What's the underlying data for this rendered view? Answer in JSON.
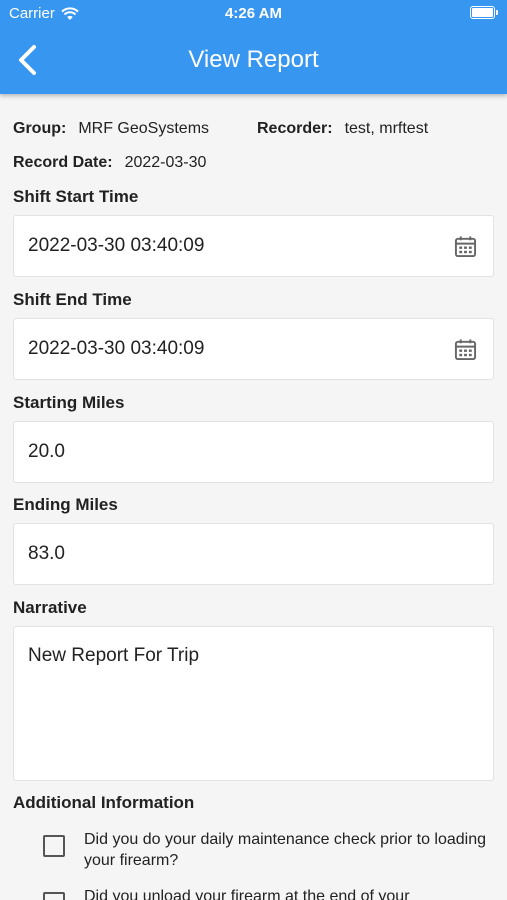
{
  "status_bar": {
    "carrier": "Carrier",
    "time": "4:26 AM"
  },
  "nav": {
    "title": "View Report",
    "back_icon": "chevron-left-icon"
  },
  "meta": {
    "group_label": "Group:",
    "group_value": "MRF GeoSystems",
    "recorder_label": "Recorder:",
    "recorder_value": "test, mrftest",
    "record_date_label": "Record Date:",
    "record_date_value": "2022-03-30"
  },
  "fields": {
    "shift_start": {
      "label": "Shift Start Time",
      "value": "2022-03-30 03:40:09",
      "icon": "calendar-icon"
    },
    "shift_end": {
      "label": "Shift End Time",
      "value": "2022-03-30 03:40:09",
      "icon": "calendar-icon"
    },
    "starting_miles": {
      "label": "Starting Miles",
      "value": "20.0"
    },
    "ending_miles": {
      "label": "Ending Miles",
      "value": "83.0"
    },
    "narrative": {
      "label": "Narrative",
      "value": "New Report For Trip"
    }
  },
  "additional": {
    "label": "Additional Information",
    "items": [
      {
        "text": "Did you do your daily maintenance check prior to loading your firearm?",
        "checked": false
      },
      {
        "text": "Did you unload your firearm at the end of your",
        "checked": false
      }
    ]
  },
  "colors": {
    "accent": "#3796f0",
    "background": "#f5f5f5"
  }
}
